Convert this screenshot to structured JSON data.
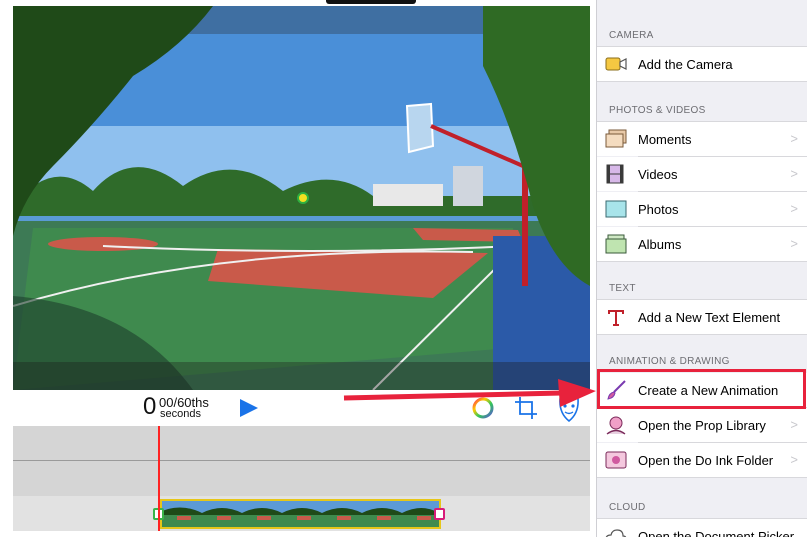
{
  "timecode": {
    "seconds": "0",
    "fraction": "00/60ths",
    "unit": "seconds"
  },
  "controls": {
    "play_icon": "play-icon",
    "color_icon": "color-wheel-icon",
    "crop_icon": "crop-icon",
    "mask_icon": "mask-icon"
  },
  "panel": {
    "sections": [
      {
        "id": "camera",
        "header": "CAMERA",
        "items": [
          {
            "label": "Add the Camera",
            "icon": "camera-icon",
            "chevron": false
          }
        ]
      },
      {
        "id": "photos",
        "header": "PHOTOS & VIDEOS",
        "items": [
          {
            "label": "Moments",
            "icon": "moments-icon",
            "chevron": true
          },
          {
            "label": "Videos",
            "icon": "film-icon",
            "chevron": true
          },
          {
            "label": "Photos",
            "icon": "photo-icon",
            "chevron": true
          },
          {
            "label": "Albums",
            "icon": "album-icon",
            "chevron": true
          }
        ]
      },
      {
        "id": "text",
        "header": "TEXT",
        "items": [
          {
            "label": "Add a New Text Element",
            "icon": "text-icon",
            "chevron": false
          }
        ]
      },
      {
        "id": "animation",
        "header": "ANIMATION & DRAWING",
        "items": [
          {
            "label": "Create a New Animation",
            "icon": "brush-icon",
            "chevron": false
          },
          {
            "label": "Open the Prop Library",
            "icon": "prop-icon",
            "chevron": true
          },
          {
            "label": "Open the Do Ink Folder",
            "icon": "folder-icon",
            "chevron": true
          }
        ]
      },
      {
        "id": "cloud",
        "header": "CLOUD",
        "items": [
          {
            "label": "Open the Document Picker",
            "icon": "cloud-icon",
            "chevron": false
          }
        ]
      }
    ],
    "chevron_glyph": ">"
  },
  "colors": {
    "highlight": "#e8223c",
    "playhead": "#ff2222",
    "clip_border": "#e6c619"
  }
}
